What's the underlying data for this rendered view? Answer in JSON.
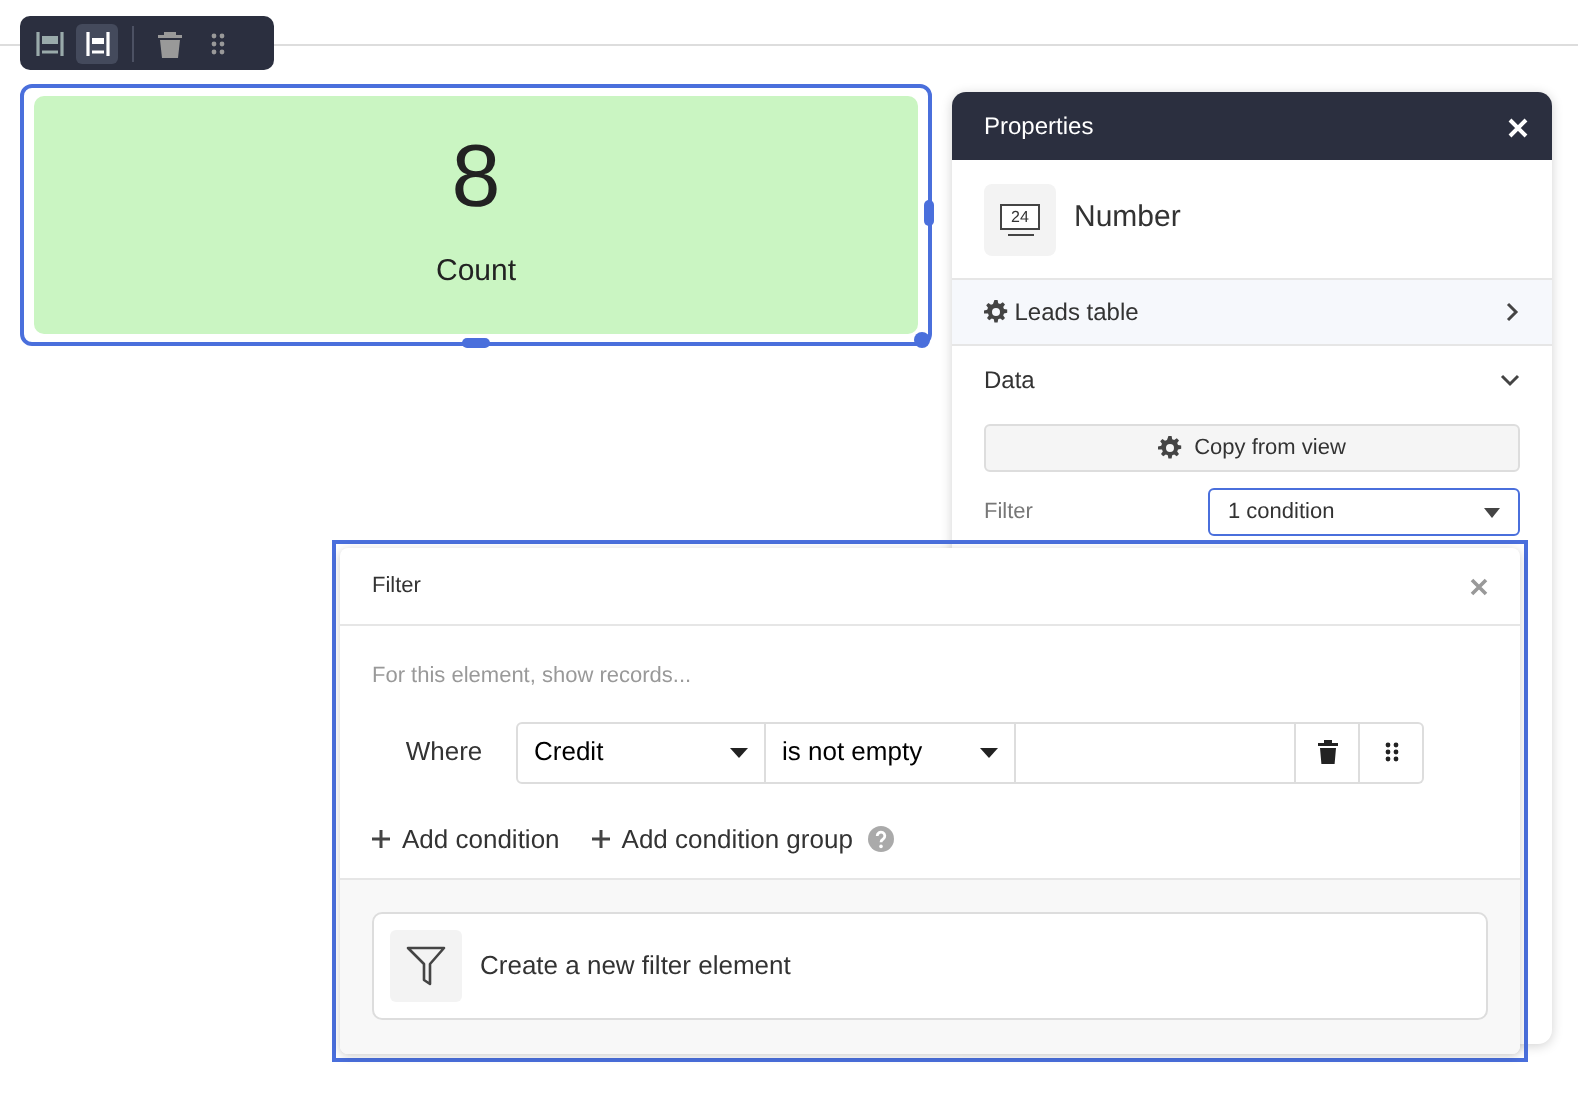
{
  "toolbar": [
    {
      "kind": "width",
      "selected": false
    },
    {
      "kind": "height",
      "selected": true
    },
    {
      "kind": "delete",
      "selected": false
    },
    {
      "kind": "drag",
      "selected": false
    }
  ],
  "widget": {
    "value": "8",
    "label": "Count",
    "selected": true
  },
  "properties": {
    "title": "Properties",
    "element_type": "Number",
    "icon_text": "24",
    "table": "Leads table",
    "section": "Data",
    "section_expanded": true,
    "copy_button": "Copy from view",
    "filter_label": "Filter",
    "filter_value": "1 condition"
  },
  "filter_popup": {
    "title": "Filter",
    "hint": "For this element, show records...",
    "conditions": [
      {
        "where": "Where",
        "field": "Credit",
        "operator": "is not empty"
      }
    ],
    "actions": [
      {
        "label": "Add condition",
        "help": false
      },
      {
        "label": "Add condition group",
        "help": true
      }
    ],
    "footer_button": "Create a new filter element"
  }
}
